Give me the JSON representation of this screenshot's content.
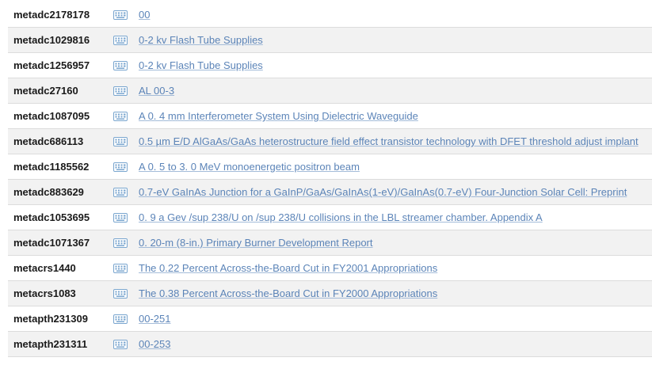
{
  "colors": {
    "link": "#4e7ab2",
    "icon": "#7aa6cf",
    "stripe": "#f2f2f2",
    "divider": "#dcdcdc"
  },
  "row_icon": "keyboard-icon",
  "records": [
    {
      "id": "metadc2178178",
      "title": "00"
    },
    {
      "id": "metadc1029816",
      "title": "0-2 kv Flash Tube Supplies"
    },
    {
      "id": "metadc1256957",
      "title": "0-2 kv Flash Tube Supplies"
    },
    {
      "id": "metadc27160",
      "title": "AL 00-3"
    },
    {
      "id": "metadc1087095",
      "title": "A 0. 4 mm Interferometer System Using Dielectric Waveguide"
    },
    {
      "id": "metadc686113",
      "title": "0.5 µm E/D AlGaAs/GaAs heterostructure field effect transistor technology with DFET threshold adjust implant"
    },
    {
      "id": "metadc1185562",
      "title": "A 0. 5 to 3. 0 MeV monoenergetic positron beam"
    },
    {
      "id": "metadc883629",
      "title": "0.7-eV GaInAs Junction for a GaInP/GaAs/GaInAs(1-eV)/GaInAs(0.7-eV) Four-Junction Solar Cell: Preprint"
    },
    {
      "id": "metadc1053695",
      "title": "0. 9 a Gev /sup 238/U on /sup 238/U collisions in the LBL streamer chamber. Appendix A"
    },
    {
      "id": "metadc1071367",
      "title": "0. 20-m (8-in.) Primary Burner Development Report"
    },
    {
      "id": "metacrs1440",
      "title": "The 0.22 Percent Across-the-Board Cut in FY2001 Appropriations"
    },
    {
      "id": "metacrs1083",
      "title": "The 0.38 Percent Across-the-Board Cut in FY2000 Appropriations"
    },
    {
      "id": "metapth231309",
      "title": "00-251"
    },
    {
      "id": "metapth231311",
      "title": "00-253"
    }
  ]
}
